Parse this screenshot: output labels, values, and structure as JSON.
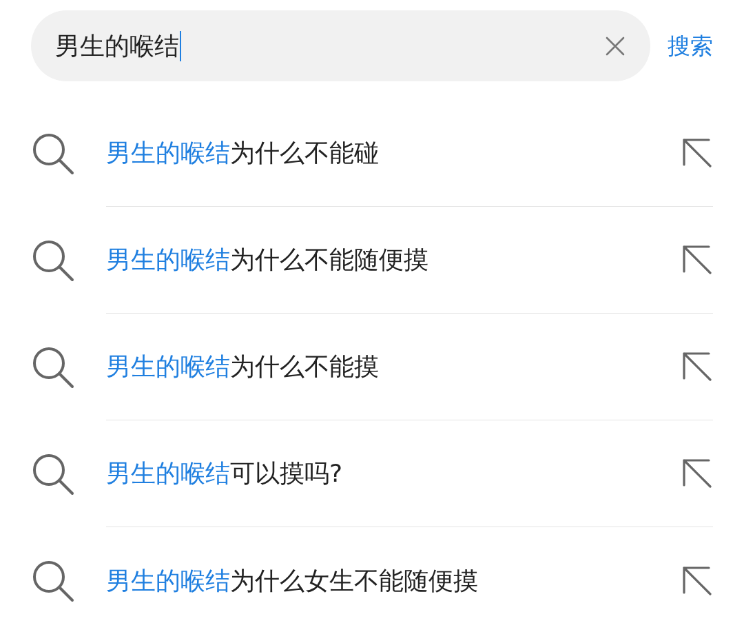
{
  "search_bar": {
    "value": "男生的喉结",
    "focused": true,
    "submit_label": "搜索"
  },
  "suggestions": [
    {
      "match": "男生的喉结",
      "rest": "为什么不能碰"
    },
    {
      "match": "男生的喉结",
      "rest": "为什么不能随便摸"
    },
    {
      "match": "男生的喉结",
      "rest": "为什么不能摸"
    },
    {
      "match": "男生的喉结",
      "rest": "可以摸吗?"
    },
    {
      "match": "男生的喉结",
      "rest": "为什么女生不能随便摸"
    }
  ]
}
